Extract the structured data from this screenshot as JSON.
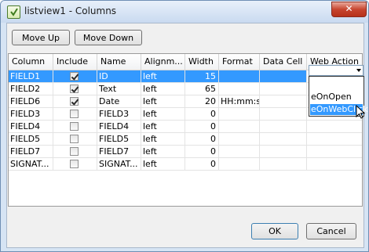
{
  "window": {
    "title": "listview1 - Columns",
    "close_glyph": "✕"
  },
  "toolbar": {
    "move_up": "Move Up",
    "move_down": "Move Down"
  },
  "columns": [
    "Column",
    "Include",
    "Name",
    "Alignm...",
    "Width",
    "Format",
    "Data Cell",
    "Web Action"
  ],
  "rows": [
    {
      "column": "FIELD1",
      "include": true,
      "name": "ID",
      "align": "left",
      "width": "15",
      "format": "",
      "datacell": "",
      "webaction": ""
    },
    {
      "column": "FIELD2",
      "include": true,
      "name": "Text",
      "align": "left",
      "width": "65",
      "format": "",
      "datacell": "",
      "webaction": ""
    },
    {
      "column": "FIELD6",
      "include": true,
      "name": "Date",
      "align": "left",
      "width": "20",
      "format": "HH:mm:ss",
      "datacell": "",
      "webaction": ""
    },
    {
      "column": "FIELD3",
      "include": false,
      "name": "FIELD3",
      "align": "left",
      "width": "0",
      "format": "",
      "datacell": "",
      "webaction": ""
    },
    {
      "column": "FIELD4",
      "include": false,
      "name": "FIELD4",
      "align": "left",
      "width": "0",
      "format": "",
      "datacell": "",
      "webaction": ""
    },
    {
      "column": "FIELD5",
      "include": false,
      "name": "FIELD5",
      "align": "left",
      "width": "0",
      "format": "",
      "datacell": "",
      "webaction": ""
    },
    {
      "column": "FIELD7",
      "include": false,
      "name": "FIELD7",
      "align": "left",
      "width": "0",
      "format": "",
      "datacell": "",
      "webaction": ""
    },
    {
      "column": "SIGNAT...",
      "include": false,
      "name": "SIGNAT...",
      "align": "left",
      "width": "0",
      "format": "",
      "datacell": "",
      "webaction": ""
    }
  ],
  "selected_row": 0,
  "webaction_dropdown": {
    "value": "",
    "options": [
      "",
      "eOnOpen",
      "eOnWebClick"
    ],
    "highlighted": 2
  },
  "footer": {
    "ok": "OK",
    "cancel": "Cancel"
  },
  "colors": {
    "selection": "#3399ff",
    "title_bg": "#d6e4f4",
    "close": "#c7452f"
  }
}
